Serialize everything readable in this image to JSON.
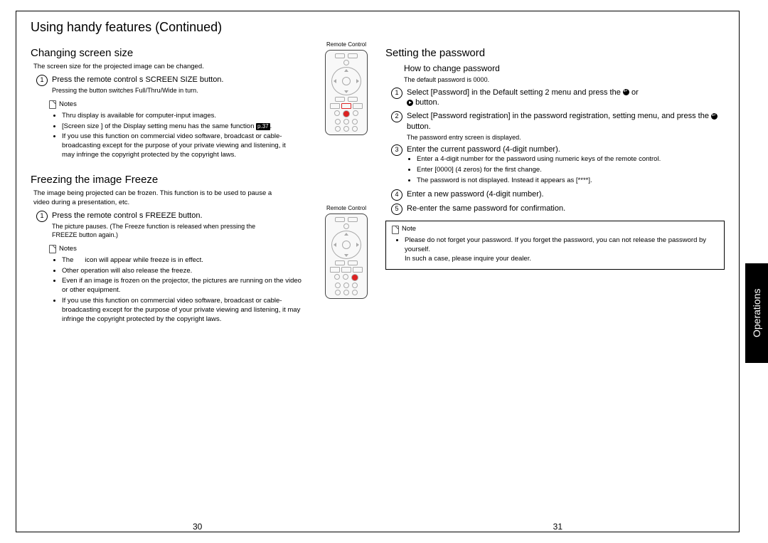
{
  "title": "Using handy features (Continued)",
  "sideTab": "Operations",
  "pageLeft": "30",
  "pageRight": "31",
  "remoteLabel": "Remote Control",
  "left": {
    "s1": {
      "heading": "Changing screen size",
      "intro": "The screen size for the projected image can be changed.",
      "step1Title": "Press the remote control s SCREEN SIZE button.",
      "step1Sub": "Pressing the button switches Full/Thru/Wide in turn.",
      "notesLabel": "Notes",
      "n1": "Thru display is available for computer-input images.",
      "n2a": "[Screen size ] of the Display setting   menu has the same function",
      "pref": "p.37",
      "n2b": ".",
      "n3": "If you use this function on commercial video software, broadcast or cable-broadcasting except for the purpose of your private viewing and listening, it may infringe the copyright protected by the copyright laws."
    },
    "s2": {
      "heading": "Freezing the image Freeze",
      "intro": "The image being projected can be frozen. This function is to be used to pause a video during a presentation, etc.",
      "step1Title": "Press the remote control s FREEZE button.",
      "step1Sub": "The picture pauses. (The Freeze function is released when pressing the FREEZE button again.)",
      "notesLabel": "Notes",
      "n1a": "The ",
      "n1b": " icon will appear while freeze is in effect.",
      "n2": "Other operation will also release the freeze.",
      "n3": "Even if an image is frozen on the projector, the pictures are running on the video or other equipment.",
      "n4": "If you use this function on commercial video software, broadcast or cable-broadcasting except for the purpose of your private viewing and listening, it may infringe the copyright protected by the copyright laws."
    }
  },
  "right": {
    "heading": "Setting the password",
    "sub": "How to change password",
    "subIntro": "The default password is 0000.",
    "step1a": "Select [Password] in the Default setting 2 menu and press the ",
    "step1b": " or ",
    "step1c": " button.",
    "step2a": "Select [Password registration] in the password registration, setting menu, and press the ",
    "step2b": " button.",
    "step2Sub": "The password entry screen is displayed.",
    "step3": "Enter the current password (4-digit number).",
    "step3n1": "Enter a 4-digit number for the password using numeric keys of the remote control.",
    "step3n2": "Enter [0000] (4 zeros) for the first change.",
    "step3n3": "The password is not displayed. Instead it appears as [****].",
    "step4": "Enter a new password (4-digit number).",
    "step5": "Re-enter the same password for confirmation.",
    "noteLabel": "Note",
    "noteBody": "Please do not forget your password. If you forget the password, you can not release the password by yourself.\nIn such a case, please inquire your dealer."
  }
}
